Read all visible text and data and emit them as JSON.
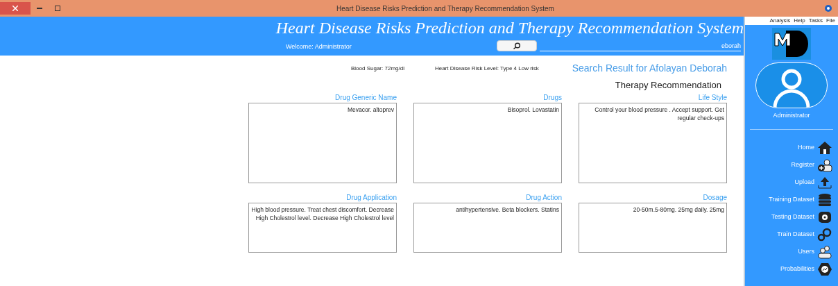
{
  "window": {
    "title": "Heart Disease Risks Prediction and Therapy Recommendation System"
  },
  "menu": [
    "Analysis",
    "Help",
    "Tasks",
    "File"
  ],
  "header": {
    "title": "Heart Disease Risks Prediction and Therapy Recommendation System",
    "search_value": "eborah",
    "welcome": "Welcome: Administrator"
  },
  "result": {
    "title": "Search Result for Afolayan Deborah",
    "risk_level": "Heart Disease Risk Level: Type 4 Low risk",
    "blood_sugar": "Blood Sugar: 72mg/dl",
    "section": "Therapy Recommendation"
  },
  "fields": [
    {
      "label": "Drug Generic Name",
      "value": "Mevacor. altoprev"
    },
    {
      "label": "Drugs",
      "value": "Bisoprol. Lovastatin"
    },
    {
      "label": "Life Style",
      "value": "Control your blood pressure . Accept support. Get regular check-ups"
    },
    {
      "label": "Drug Application",
      "value": "High blood pressure. Treat chest discomfort. Decrease High Cholestrol level. Decrease High Cholestrol level"
    },
    {
      "label": "Drug Action",
      "value": "antihypertensive. Beta blockers. Statins"
    },
    {
      "label": "Dosage",
      "value": "20-50m.5-80mg. 25mg daily. 25mg"
    }
  ],
  "sidebar": {
    "user": "Administrator",
    "items": [
      {
        "label": "Home",
        "kind": "home"
      },
      {
        "label": "Register",
        "kind": "register"
      },
      {
        "label": "Upload",
        "kind": "upload"
      },
      {
        "label": "Training Dataset",
        "kind": "database"
      },
      {
        "label": "Testing Dataset",
        "kind": "testing"
      },
      {
        "label": "Train Dataset",
        "kind": "gears"
      },
      {
        "label": "Users",
        "kind": "users"
      },
      {
        "label": "Probabilities",
        "kind": "probabilities"
      }
    ]
  }
}
